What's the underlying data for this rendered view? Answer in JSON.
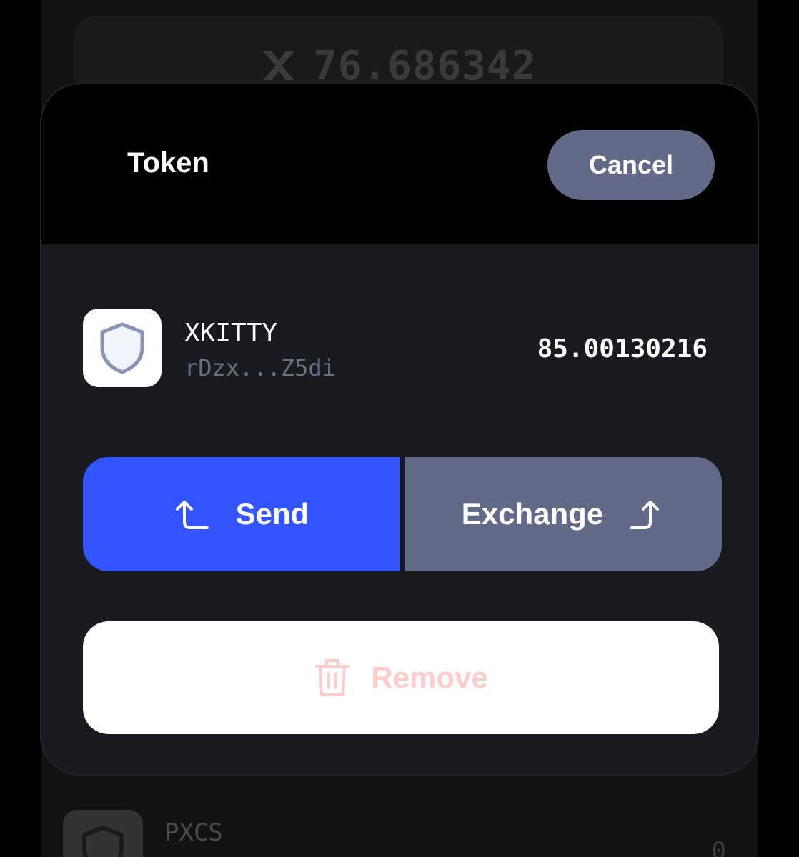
{
  "background": {
    "balance_value": "76.686342",
    "balance_icon": "xrp-icon",
    "list_item": {
      "name": "PXCS",
      "amount": "0",
      "icon": "shield-icon"
    }
  },
  "sheet": {
    "title": "Token",
    "cancel_label": "Cancel",
    "token": {
      "name": "XKITTY",
      "address": "rDzx...Z5di",
      "amount": "85.00130216",
      "icon": "shield-icon"
    },
    "actions": {
      "send_label": "Send",
      "send_icon": "send-arrow-icon",
      "exchange_label": "Exchange",
      "exchange_icon": "exchange-arrow-icon"
    },
    "remove_label": "Remove",
    "remove_icon": "trash-icon"
  },
  "colors": {
    "send": "#3454ff",
    "secondary": "#636a87",
    "sheet_bg": "#1a1b21",
    "remove_text": "#ffcccc"
  }
}
